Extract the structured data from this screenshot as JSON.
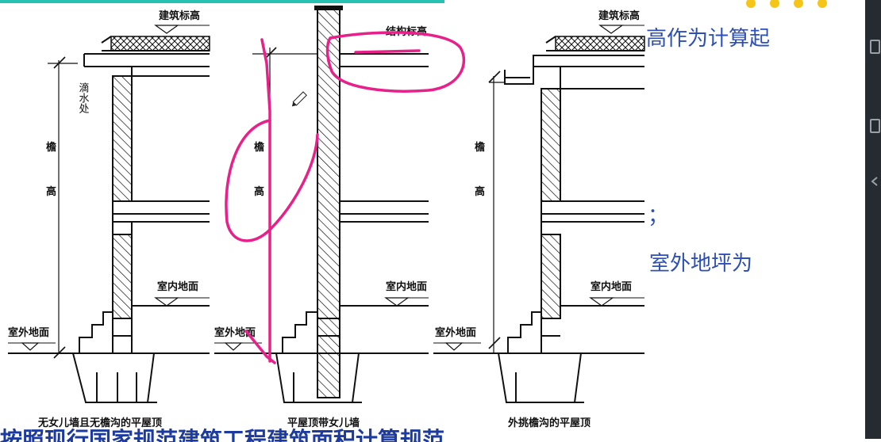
{
  "slide": {
    "text_top": "高作为计算起",
    "text_mid": "；",
    "text_lower": "室外地坪为",
    "text_bottom": "按照现行国家规范建筑工程建筑面积计算规范"
  },
  "figure": {
    "panel1": {
      "roof_label": "建筑标高",
      "drip_label": "滴水处",
      "eave_label_1": "檐",
      "eave_label_2": "高",
      "indoor_label": "室内地面",
      "outdoor_label": "室外地面",
      "caption": "无女儿墙且无檐沟的平屋顶"
    },
    "panel2": {
      "roof_label": "结构标高",
      "eave_label_1": "檐",
      "eave_label_2": "高",
      "indoor_label": "室内地面",
      "outdoor_label": "室外地面",
      "caption": "平屋顶带女儿墙"
    },
    "panel3": {
      "roof_label": "建筑标高",
      "eave_label_1": "檐",
      "eave_label_2": "高",
      "indoor_label": "室内地面",
      "outdoor_label": "室外地面",
      "caption": "外挑檐沟的平屋顶"
    }
  },
  "colors": {
    "annotation_pen": "#e8208a",
    "slide_text": "#2c4fb8",
    "accent_teal": "#28c2b3",
    "accent_yellow": "#f5c518",
    "sidebar": "#262a31"
  },
  "icons": [
    "pencil-cursor-icon",
    "sidebar-page-icon",
    "sidebar-chevron-icon"
  ]
}
